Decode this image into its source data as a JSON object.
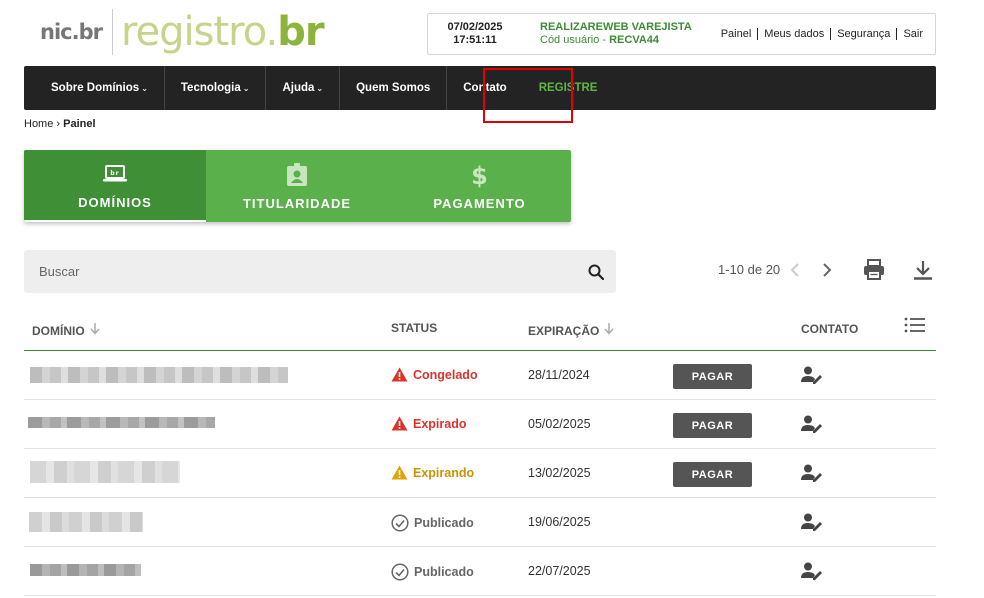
{
  "header": {
    "nic_logo": "nic.br",
    "registro_logo_main": "registro.",
    "registro_logo_suffix": "br",
    "date": "07/02/2025",
    "time": "17:51:11",
    "company_name": "REALIZAREWEB VAREJISTA",
    "user_code_label": "Cód usuário - ",
    "user_code": "RECVA44",
    "links": [
      "Painel",
      "Meus dados",
      "Segurança",
      "Sair"
    ]
  },
  "nav": {
    "items": [
      {
        "label": "Sobre Domínios",
        "dropdown": true
      },
      {
        "label": "Tecnologia",
        "dropdown": true
      },
      {
        "label": "Ajuda",
        "dropdown": true
      },
      {
        "label": "Quem Somos",
        "dropdown": false
      },
      {
        "label": "Contato",
        "dropdown": false
      },
      {
        "label": "REGISTRE",
        "dropdown": false
      }
    ],
    "caret": "⌄"
  },
  "breadcrumb": {
    "home": "Home",
    "separator": "›",
    "current": "Painel"
  },
  "tabs": [
    {
      "label": "DOMÍNIOS",
      "icon": "laptop-icon",
      "active": true
    },
    {
      "label": "TITULARIDADE",
      "icon": "id-badge-icon",
      "active": false
    },
    {
      "label": "PAGAMENTO",
      "icon": "dollar-icon",
      "active": false
    }
  ],
  "search": {
    "placeholder": "Buscar",
    "value": ""
  },
  "pagination": {
    "range": "1-10 de 20"
  },
  "table": {
    "headers": {
      "domain": "DOMÍNIO",
      "status": "STATUS",
      "expiration": "EXPIRAÇÃO",
      "contact": "CONTATO"
    },
    "pay_label": "PAGAR",
    "rows": [
      {
        "status": "Congelado",
        "status_type": "error",
        "expiration": "28/11/2024",
        "pay": true
      },
      {
        "status": "Expirado",
        "status_type": "error",
        "expiration": "05/02/2025",
        "pay": true
      },
      {
        "status": "Expirando",
        "status_type": "warning",
        "expiration": "13/02/2025",
        "pay": true
      },
      {
        "status": "Publicado",
        "status_type": "ok",
        "expiration": "19/06/2025",
        "pay": false
      },
      {
        "status": "Publicado",
        "status_type": "ok",
        "expiration": "22/07/2025",
        "pay": false
      }
    ]
  },
  "colors": {
    "brand_green": "#3d8b37",
    "tab_green": "#5ab04a",
    "error_red": "#d9342b",
    "warning_yellow": "#c99306",
    "nav_dark": "#232323"
  }
}
